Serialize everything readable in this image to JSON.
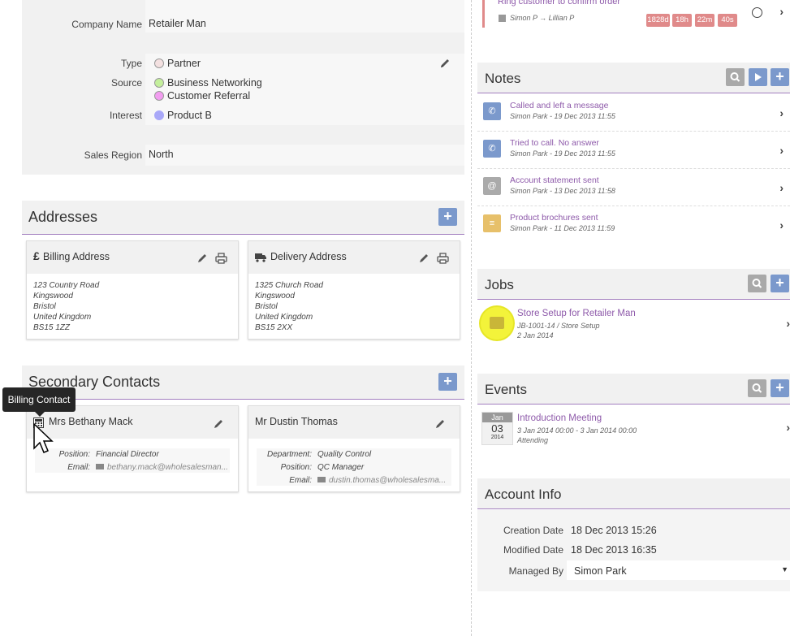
{
  "organisation": {
    "company_name_label": "Company Name",
    "company_name": "Retailer Man",
    "type_label": "Type",
    "type_value": "Partner",
    "source_label": "Source",
    "sources": [
      "Business Networking",
      "Customer Referral"
    ],
    "interest_label": "Interest",
    "interest_value": "Product B",
    "sales_region_label": "Sales Region",
    "sales_region": "North",
    "colors": {
      "partner": "#f3e0e0",
      "business_networking": "#c4ef9c",
      "customer_referral": "#f29df0",
      "product_b": "#a9a8f8"
    }
  },
  "addresses": {
    "title": "Addresses",
    "billing": {
      "title": "Billing Address",
      "lines": [
        "123 Country Road",
        "Kingswood",
        "Bristol",
        "United Kingdom",
        "BS15 1ZZ"
      ]
    },
    "delivery": {
      "title": "Delivery Address",
      "lines": [
        "1325 Church Road",
        "Kingswood",
        "Bristol",
        "United Kingdom",
        "BS15 2XX"
      ]
    }
  },
  "secondary_contacts": {
    "title": "Secondary Contacts",
    "tooltip": "Billing Contact",
    "contacts": [
      {
        "name": "Mrs Bethany Mack",
        "position_label": "Position:",
        "position": "Financial Director",
        "email_label": "Email:",
        "email": "bethany.mack@wholesalesman..."
      },
      {
        "name": "Mr Dustin Thomas",
        "department_label": "Department:",
        "department": "Quality Control",
        "position_label": "Position:",
        "position": "QC Manager",
        "email_label": "Email:",
        "email": "dustin.thomas@wholesalesma..."
      }
    ]
  },
  "task": {
    "title": "Ring customer to confirm order",
    "assignment": "Simon P → Lillian P",
    "badges": [
      "1828d",
      "18h",
      "22m",
      "40s"
    ]
  },
  "notes": {
    "title": "Notes",
    "items": [
      {
        "title": "Called and left a message",
        "sub": "Simon Park - 19 Dec 2013 11:55",
        "icon": "phone-icon",
        "color": "#7b99cc"
      },
      {
        "title": "Tried to call. No answer",
        "sub": "Simon Park - 19 Dec 2013 11:55",
        "icon": "phone-icon",
        "color": "#7b99cc"
      },
      {
        "title": "Account statement sent",
        "sub": "Simon Park - 13 Dec 2013 11:58",
        "icon": "at-icon",
        "color": "#aaaaaa"
      },
      {
        "title": "Product brochures sent",
        "sub": "Simon Park - 11 Dec 2013 11:59",
        "icon": "document-icon",
        "color": "#e7c06a"
      }
    ]
  },
  "jobs": {
    "title": "Jobs",
    "items": [
      {
        "title": "Store Setup for Retailer Man",
        "ref": "JB-1001-14 / Store Setup",
        "date": "2 Jan 2014"
      }
    ]
  },
  "events": {
    "title": "Events",
    "items": [
      {
        "month": "Jan",
        "day": "03",
        "year": "2014",
        "title": "Introduction Meeting",
        "time": "3 Jan 2014 00:00 - 3 Jan 2014 00:00",
        "status": "Attending"
      }
    ]
  },
  "account_info": {
    "title": "Account Info",
    "creation_label": "Creation Date",
    "creation": "18 Dec 2013 15:26",
    "modified_label": "Modified Date",
    "modified": "18 Dec 2013 16:35",
    "managed_label": "Managed By",
    "managed": "Simon Park"
  },
  "colors": {
    "accent": "#7b99cc",
    "purple_text": "#8e5aaa",
    "badge": "#e08a8a",
    "divider": "#a37fbf"
  }
}
